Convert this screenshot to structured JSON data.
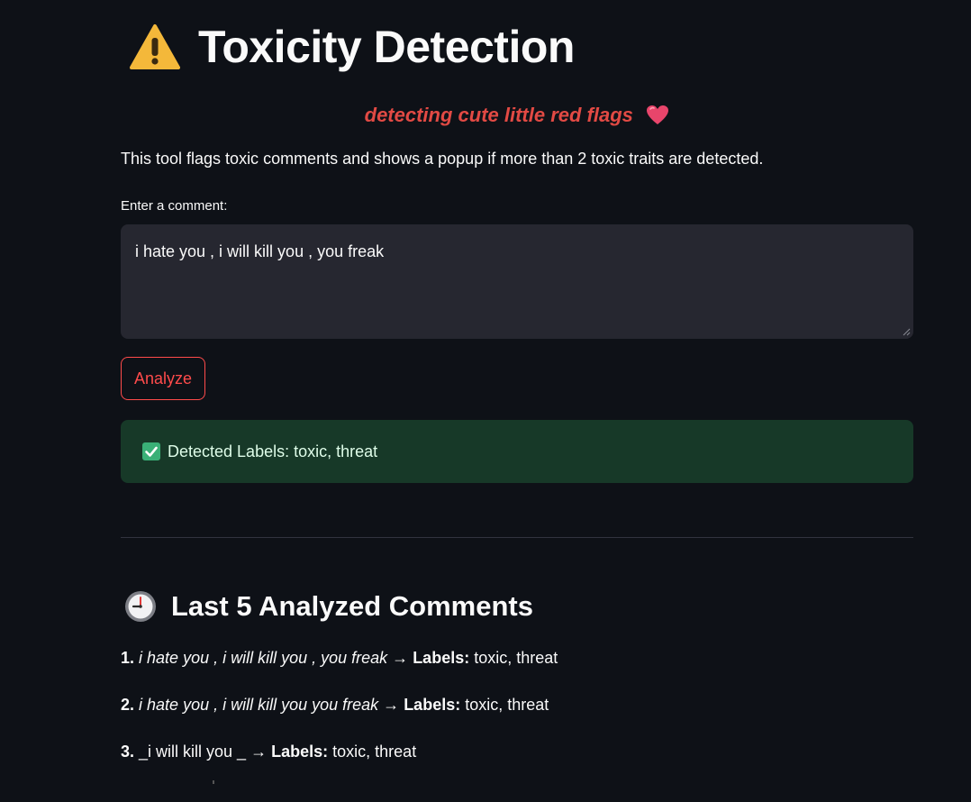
{
  "header": {
    "title": "Toxicity Detection",
    "title_icon": "warning-icon",
    "subtitle": "detecting cute little red flags",
    "subtitle_icon": "heart-icon"
  },
  "description": "This tool flags toxic comments and shows a popup if more than 2 toxic traits are detected.",
  "input": {
    "label": "Enter a comment:",
    "value": "i hate you , i will kill you , you freak"
  },
  "analyze_button": {
    "label": "Analyze"
  },
  "result": {
    "icon": "check-icon",
    "text": "Detected Labels: toxic, threat"
  },
  "history": {
    "icon": "clock-icon",
    "title": "Last 5 Analyzed Comments",
    "labels_prefix": "Labels:",
    "arrow": "→",
    "items": [
      {
        "number": "1.",
        "comment": "i hate you , i will kill you , you freak",
        "labels": "toxic, threat"
      },
      {
        "number": "2.",
        "comment": "i hate you , i will kill you you freak",
        "labels": "toxic, threat"
      },
      {
        "number": "3.",
        "comment": "_i will kill you _",
        "labels": "toxic, threat"
      }
    ]
  },
  "colors": {
    "background": "#0e1117",
    "accent_red": "#ff4b4b",
    "subtitle_red": "#e24a44",
    "input_bg": "#262730",
    "success_bg": "#173928",
    "success_text": "#dffde9"
  }
}
